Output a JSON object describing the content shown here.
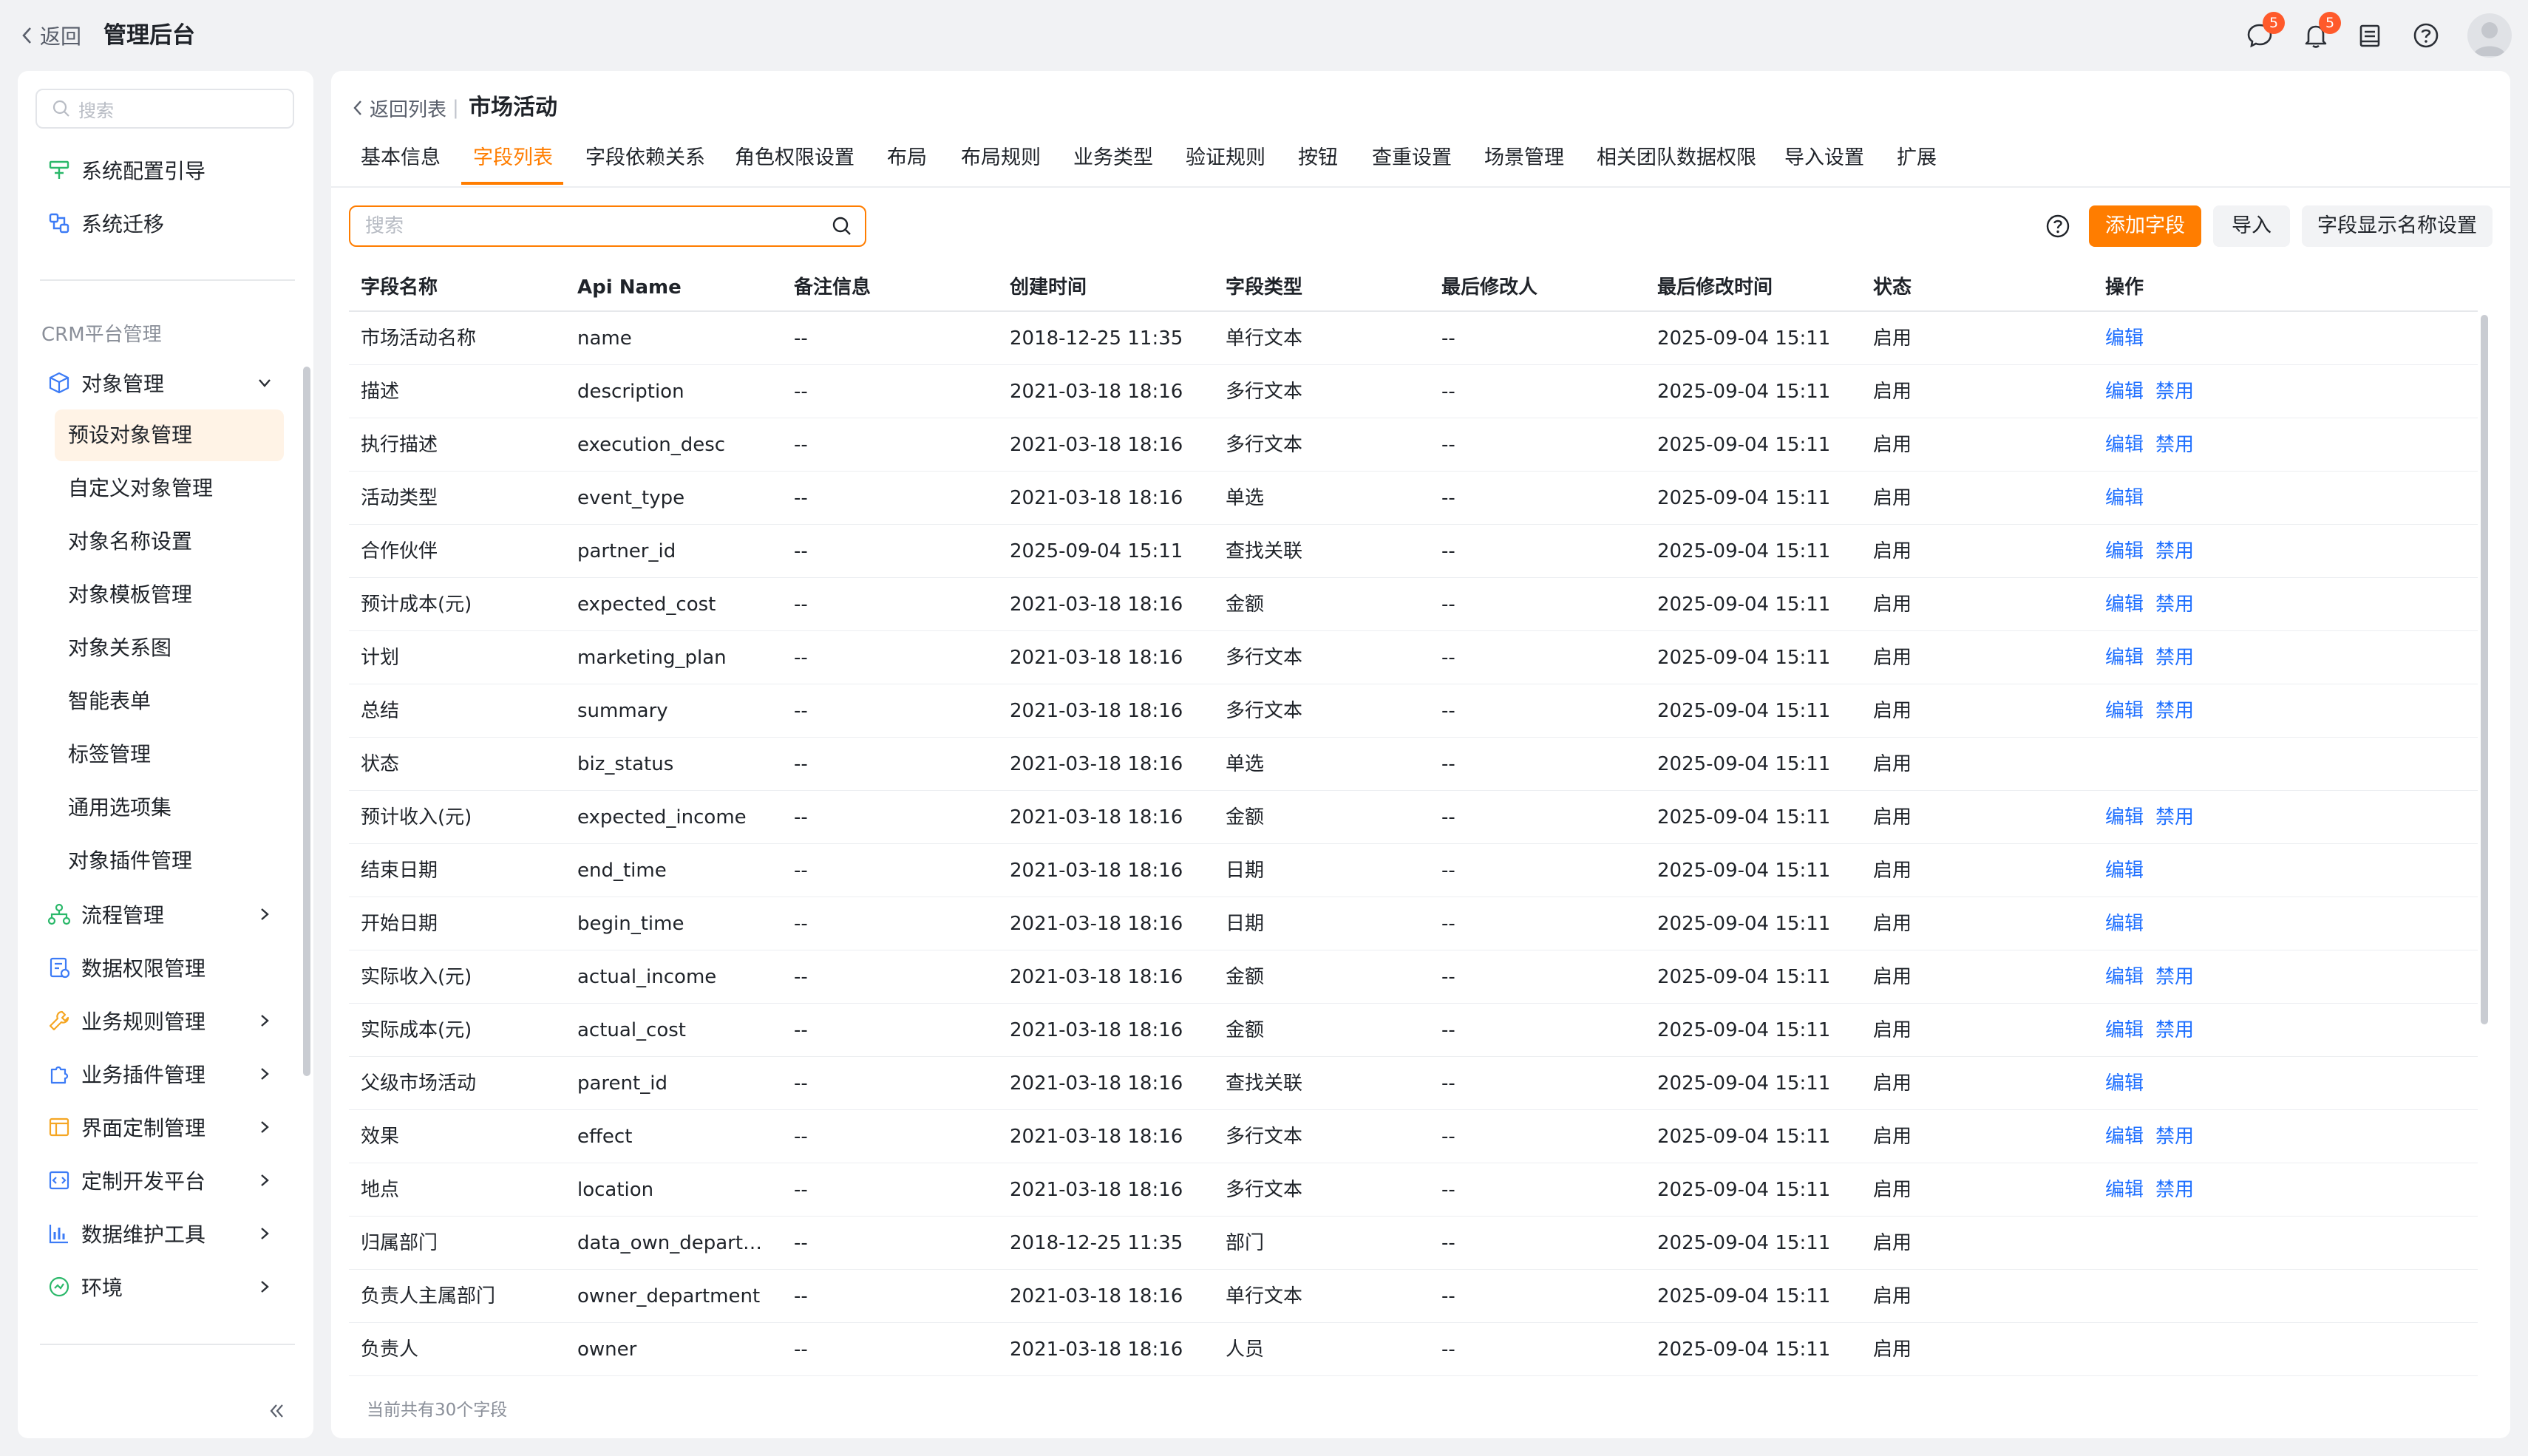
{
  "topbar": {
    "back_label": "返回",
    "title": "管理后台",
    "chat_badge": "5",
    "bell_badge": "5",
    "icons": [
      "chat-icon",
      "bell-icon",
      "notebook-icon",
      "help-icon",
      "avatar"
    ]
  },
  "sidebar": {
    "search_placeholder": "搜索",
    "top_items": [
      "系统配置引导",
      "系统迁移"
    ],
    "section_title": "CRM平台管理",
    "object_mgmt": "对象管理",
    "sub_items": [
      "预设对象管理",
      "自定义对象管理",
      "对象名称设置",
      "对象模板管理",
      "对象关系图",
      "智能表单",
      "标签管理",
      "通用选项集",
      "对象插件管理"
    ],
    "groups": [
      "流程管理",
      "数据权限管理",
      "业务规则管理",
      "业务插件管理",
      "界面定制管理",
      "定制开发平台",
      "数据维护工具",
      "环境"
    ],
    "accent_color": "#ff7d00",
    "active_bg": "#fff3e6"
  },
  "main": {
    "breadcrumb_back": "返回列表",
    "breadcrumb_sep": "|",
    "title": "市场活动",
    "tabs": [
      "基本信息",
      "字段列表",
      "字段依赖关系",
      "角色权限设置",
      "布局",
      "布局规则",
      "业务类型",
      "验证规则",
      "按钮",
      "查重设置",
      "场景管理",
      "相关团队数据权限",
      "导入设置",
      "扩展"
    ],
    "active_tab": "字段列表",
    "search_placeholder": "搜索",
    "buttons": {
      "add_field": "添加字段",
      "import": "导入",
      "display_name": "字段显示名称设置"
    },
    "columns": [
      "字段名称",
      "Api Name",
      "备注信息",
      "创建时间",
      "字段类型",
      "最后修改人",
      "最后修改时间",
      "状态",
      "操作"
    ],
    "op_edit": "编辑",
    "op_disable": "禁用",
    "rows": [
      {
        "name": "市场活动名称",
        "api": "name",
        "note": "--",
        "created": "2018-12-25 11:35",
        "type": "单行文本",
        "modifier": "--",
        "modified": "2025-09-04 15:11",
        "status": "启用",
        "ops": [
          "编辑"
        ]
      },
      {
        "name": "描述",
        "api": "description",
        "note": "--",
        "created": "2021-03-18 18:16",
        "type": "多行文本",
        "modifier": "--",
        "modified": "2025-09-04 15:11",
        "status": "启用",
        "ops": [
          "编辑",
          "禁用"
        ]
      },
      {
        "name": "执行描述",
        "api": "execution_desc",
        "note": "--",
        "created": "2021-03-18 18:16",
        "type": "多行文本",
        "modifier": "--",
        "modified": "2025-09-04 15:11",
        "status": "启用",
        "ops": [
          "编辑",
          "禁用"
        ]
      },
      {
        "name": "活动类型",
        "api": "event_type",
        "note": "--",
        "created": "2021-03-18 18:16",
        "type": "单选",
        "modifier": "--",
        "modified": "2025-09-04 15:11",
        "status": "启用",
        "ops": [
          "编辑"
        ]
      },
      {
        "name": "合作伙伴",
        "api": "partner_id",
        "note": "--",
        "created": "2025-09-04 15:11",
        "type": "查找关联",
        "modifier": "--",
        "modified": "2025-09-04 15:11",
        "status": "启用",
        "ops": [
          "编辑",
          "禁用"
        ]
      },
      {
        "name": "预计成本(元)",
        "api": "expected_cost",
        "note": "--",
        "created": "2021-03-18 18:16",
        "type": "金额",
        "modifier": "--",
        "modified": "2025-09-04 15:11",
        "status": "启用",
        "ops": [
          "编辑",
          "禁用"
        ]
      },
      {
        "name": "计划",
        "api": "marketing_plan",
        "note": "--",
        "created": "2021-03-18 18:16",
        "type": "多行文本",
        "modifier": "--",
        "modified": "2025-09-04 15:11",
        "status": "启用",
        "ops": [
          "编辑",
          "禁用"
        ]
      },
      {
        "name": "总结",
        "api": "summary",
        "note": "--",
        "created": "2021-03-18 18:16",
        "type": "多行文本",
        "modifier": "--",
        "modified": "2025-09-04 15:11",
        "status": "启用",
        "ops": [
          "编辑",
          "禁用"
        ]
      },
      {
        "name": "状态",
        "api": "biz_status",
        "note": "--",
        "created": "2021-03-18 18:16",
        "type": "单选",
        "modifier": "--",
        "modified": "2025-09-04 15:11",
        "status": "启用",
        "ops": []
      },
      {
        "name": "预计收入(元)",
        "api": "expected_income",
        "note": "--",
        "created": "2021-03-18 18:16",
        "type": "金额",
        "modifier": "--",
        "modified": "2025-09-04 15:11",
        "status": "启用",
        "ops": [
          "编辑",
          "禁用"
        ]
      },
      {
        "name": "结束日期",
        "api": "end_time",
        "note": "--",
        "created": "2021-03-18 18:16",
        "type": "日期",
        "modifier": "--",
        "modified": "2025-09-04 15:11",
        "status": "启用",
        "ops": [
          "编辑"
        ]
      },
      {
        "name": "开始日期",
        "api": "begin_time",
        "note": "--",
        "created": "2021-03-18 18:16",
        "type": "日期",
        "modifier": "--",
        "modified": "2025-09-04 15:11",
        "status": "启用",
        "ops": [
          "编辑"
        ]
      },
      {
        "name": "实际收入(元)",
        "api": "actual_income",
        "note": "--",
        "created": "2021-03-18 18:16",
        "type": "金额",
        "modifier": "--",
        "modified": "2025-09-04 15:11",
        "status": "启用",
        "ops": [
          "编辑",
          "禁用"
        ]
      },
      {
        "name": "实际成本(元)",
        "api": "actual_cost",
        "note": "--",
        "created": "2021-03-18 18:16",
        "type": "金额",
        "modifier": "--",
        "modified": "2025-09-04 15:11",
        "status": "启用",
        "ops": [
          "编辑",
          "禁用"
        ]
      },
      {
        "name": "父级市场活动",
        "api": "parent_id",
        "note": "--",
        "created": "2021-03-18 18:16",
        "type": "查找关联",
        "modifier": "--",
        "modified": "2025-09-04 15:11",
        "status": "启用",
        "ops": [
          "编辑"
        ]
      },
      {
        "name": "效果",
        "api": "effect",
        "note": "--",
        "created": "2021-03-18 18:16",
        "type": "多行文本",
        "modifier": "--",
        "modified": "2025-09-04 15:11",
        "status": "启用",
        "ops": [
          "编辑",
          "禁用"
        ]
      },
      {
        "name": "地点",
        "api": "location",
        "note": "--",
        "created": "2021-03-18 18:16",
        "type": "多行文本",
        "modifier": "--",
        "modified": "2025-09-04 15:11",
        "status": "启用",
        "ops": [
          "编辑",
          "禁用"
        ]
      },
      {
        "name": "归属部门",
        "api": "data_own_departm…",
        "note": "--",
        "created": "2018-12-25 11:35",
        "type": "部门",
        "modifier": "--",
        "modified": "2025-09-04 15:11",
        "status": "启用",
        "ops": []
      },
      {
        "name": "负责人主属部门",
        "api": "owner_department",
        "note": "--",
        "created": "2021-03-18 18:16",
        "type": "单行文本",
        "modifier": "--",
        "modified": "2025-09-04 15:11",
        "status": "启用",
        "ops": []
      },
      {
        "name": "负责人",
        "api": "owner",
        "note": "--",
        "created": "2021-03-18 18:16",
        "type": "人员",
        "modifier": "--",
        "modified": "2025-09-04 15:11",
        "status": "启用",
        "ops": []
      }
    ],
    "footer_count": "当前共有30个字段"
  }
}
